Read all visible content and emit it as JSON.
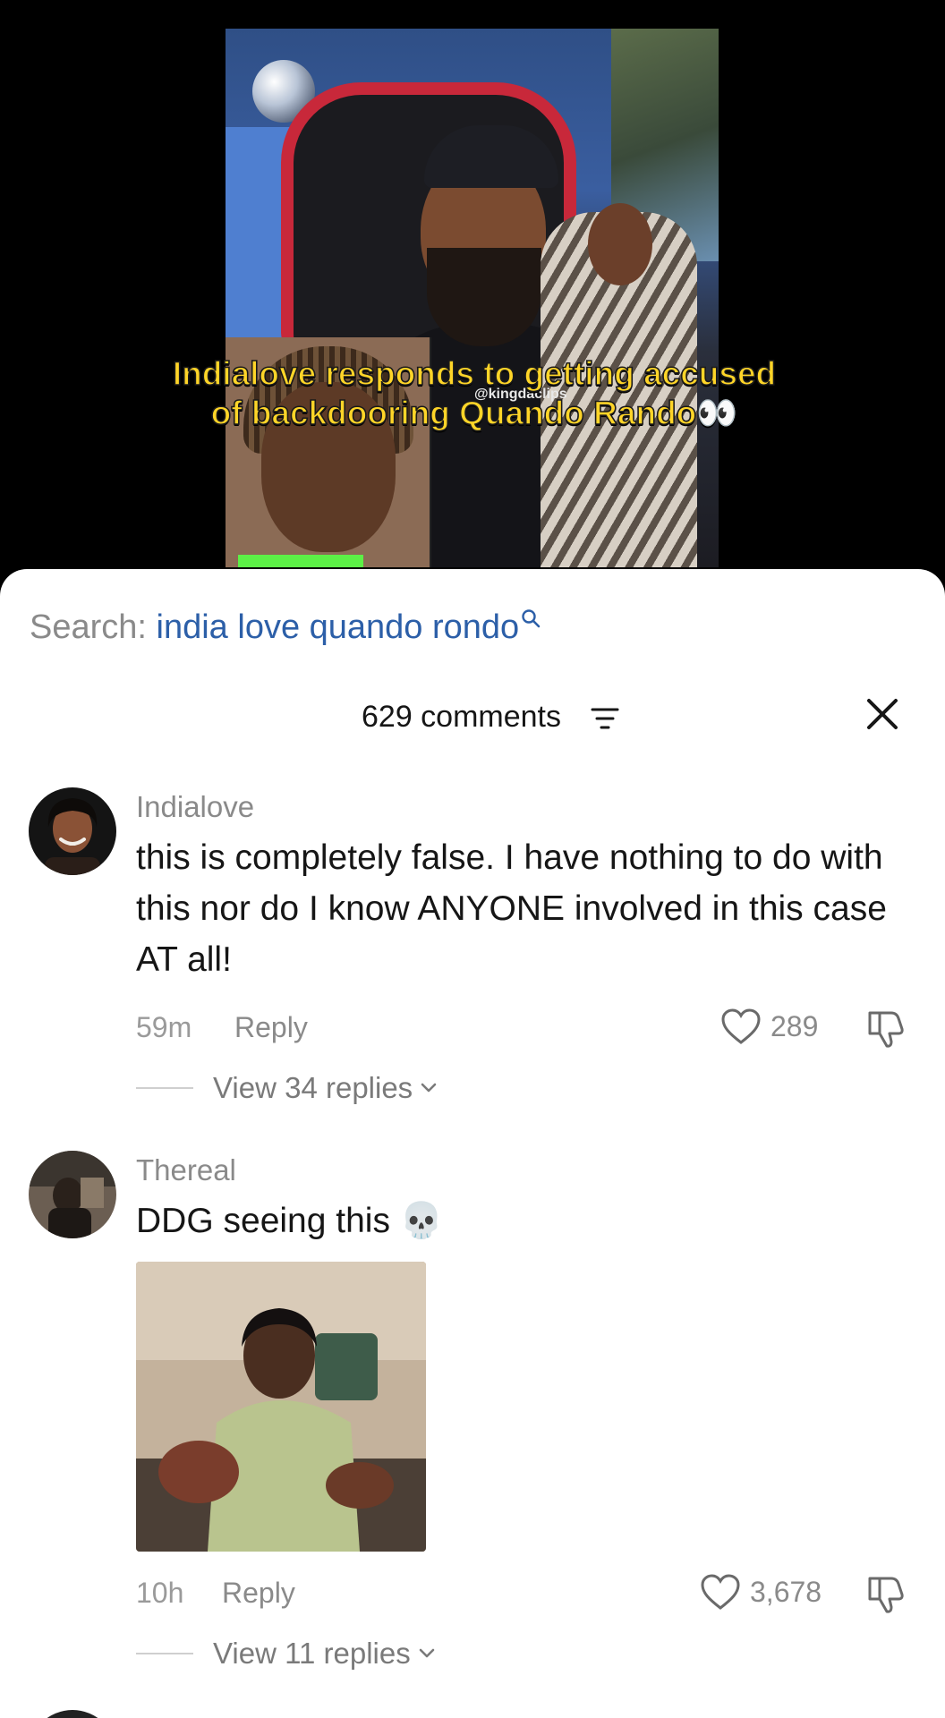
{
  "video": {
    "caption_line1": "Indialove responds to getting accused",
    "caption_line2": "of backdooring Quando Rando",
    "caption_emoji": "👀",
    "watermark": "@kingdaclips"
  },
  "search": {
    "label": "Search:",
    "query": "india love quando rondo"
  },
  "comments_header": {
    "count_label": "629 comments"
  },
  "comments": [
    {
      "username": "Indialove",
      "text": "this is completely false. I have nothing to do with this nor do I know ANYONE involved in this case AT all!",
      "time": "59m",
      "reply_label": "Reply",
      "likes": "289",
      "view_replies": "View 34 replies"
    },
    {
      "username": "Thereal",
      "text": "DDG seeing this 💀",
      "time": "10h",
      "reply_label": "Reply",
      "likes": "3,678",
      "view_replies": "View 11 replies"
    }
  ],
  "icons": {
    "search": "search-icon",
    "filter": "filter-icon",
    "close": "close-icon",
    "like": "heart-icon",
    "dislike": "thumbs-down-icon",
    "expand": "chevron-down-icon"
  }
}
